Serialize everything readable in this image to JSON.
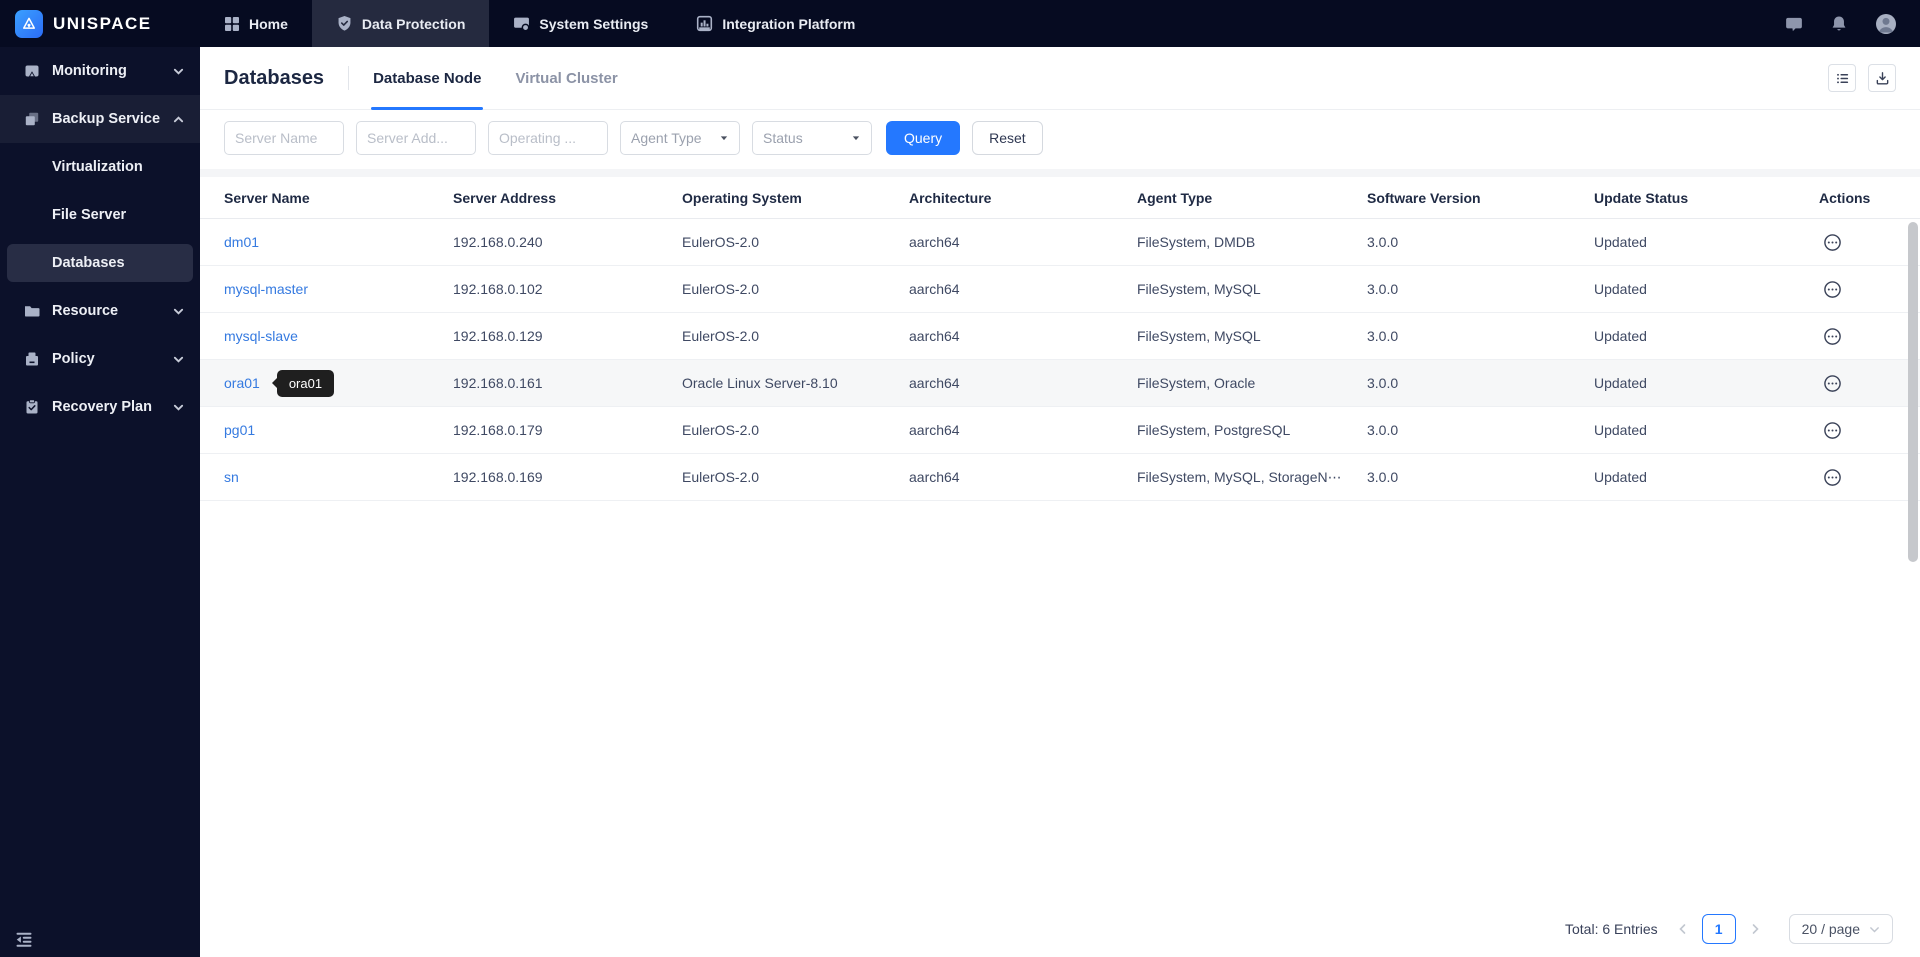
{
  "brand": {
    "name": "UNISPACE"
  },
  "topnav": {
    "items": [
      {
        "label": "Home"
      },
      {
        "label": "Data Protection"
      },
      {
        "label": "System Settings"
      },
      {
        "label": "Integration Platform"
      }
    ]
  },
  "sidebar": {
    "items": [
      {
        "label": "Monitoring"
      },
      {
        "label": "Backup Service"
      },
      {
        "label": "Virtualization"
      },
      {
        "label": "File Server"
      },
      {
        "label": "Databases"
      },
      {
        "label": "Resource"
      },
      {
        "label": "Policy"
      },
      {
        "label": "Recovery Plan"
      }
    ]
  },
  "page": {
    "title": "Databases",
    "tabs": [
      {
        "label": "Database Node"
      },
      {
        "label": "Virtual Cluster"
      }
    ]
  },
  "filters": {
    "server_name_placeholder": "Server Name",
    "server_address_placeholder": "Server Add...",
    "operating_system_placeholder": "Operating ...",
    "agent_type_placeholder": "Agent Type",
    "status_placeholder": "Status",
    "query_label": "Query",
    "reset_label": "Reset"
  },
  "table": {
    "columns": [
      "Server Name",
      "Server Address",
      "Operating System",
      "Architecture",
      "Agent Type",
      "Software Version",
      "Update Status",
      "Actions"
    ],
    "rows": [
      {
        "server_name": "dm01",
        "server_address": "192.168.0.240",
        "os": "EulerOS-2.0",
        "arch": "aarch64",
        "agent_type": "FileSystem, DMDB",
        "software_version": "3.0.0",
        "update_status": "Updated"
      },
      {
        "server_name": "mysql-master",
        "server_address": "192.168.0.102",
        "os": "EulerOS-2.0",
        "arch": "aarch64",
        "agent_type": "FileSystem, MySQL",
        "software_version": "3.0.0",
        "update_status": "Updated"
      },
      {
        "server_name": "mysql-slave",
        "server_address": "192.168.0.129",
        "os": "EulerOS-2.0",
        "arch": "aarch64",
        "agent_type": "FileSystem, MySQL",
        "software_version": "3.0.0",
        "update_status": "Updated"
      },
      {
        "server_name": "ora01",
        "server_address": "192.168.0.161",
        "os": "Oracle Linux Server-8.10",
        "arch": "aarch64",
        "agent_type": "FileSystem, Oracle",
        "software_version": "3.0.0",
        "update_status": "Updated",
        "hover": true,
        "tooltip": "ora01"
      },
      {
        "server_name": "pg01",
        "server_address": "192.168.0.179",
        "os": "EulerOS-2.0",
        "arch": "aarch64",
        "agent_type": "FileSystem, PostgreSQL",
        "software_version": "3.0.0",
        "update_status": "Updated"
      },
      {
        "server_name": "sn",
        "server_address": "192.168.0.169",
        "os": "EulerOS-2.0",
        "arch": "aarch64",
        "agent_type": "FileSystem, MySQL, StorageN⋯",
        "software_version": "3.0.0",
        "update_status": "Updated"
      }
    ]
  },
  "pagination": {
    "total_text": "Total: 6 Entries",
    "current_page": "1",
    "page_size": "20 / page"
  },
  "icons": {
    "logo": "mountain-badge",
    "home": "grid",
    "data_protection": "shield-check",
    "system_settings": "monitor-dot",
    "integration_platform": "chart-window",
    "messages": "chat-bubble",
    "notifications": "bell",
    "user": "avatar",
    "monitoring": "screen-cursor",
    "backup_service": "copy",
    "resource": "folder",
    "policy": "archive",
    "recovery_plan": "clipboard-check",
    "collapse": "indent-left",
    "toolbar": [
      "list-view",
      "download"
    ],
    "row_action": "circle-ellipsis",
    "selects": "caret-down",
    "pager": [
      "chevron-left",
      "chevron-right",
      "chevron-down"
    ]
  },
  "colors": {
    "topnav_bg": "#060B21",
    "sidebar_bg": "#0C112A",
    "nav_active_bg": "#252A3F",
    "sidebar_selected_bg": "#282D45",
    "accent_blue": "#2478FF",
    "link_blue": "#357AE0",
    "tooltip_bg": "#1F1F1F",
    "row_hover_bg": "#F6F7F8"
  }
}
